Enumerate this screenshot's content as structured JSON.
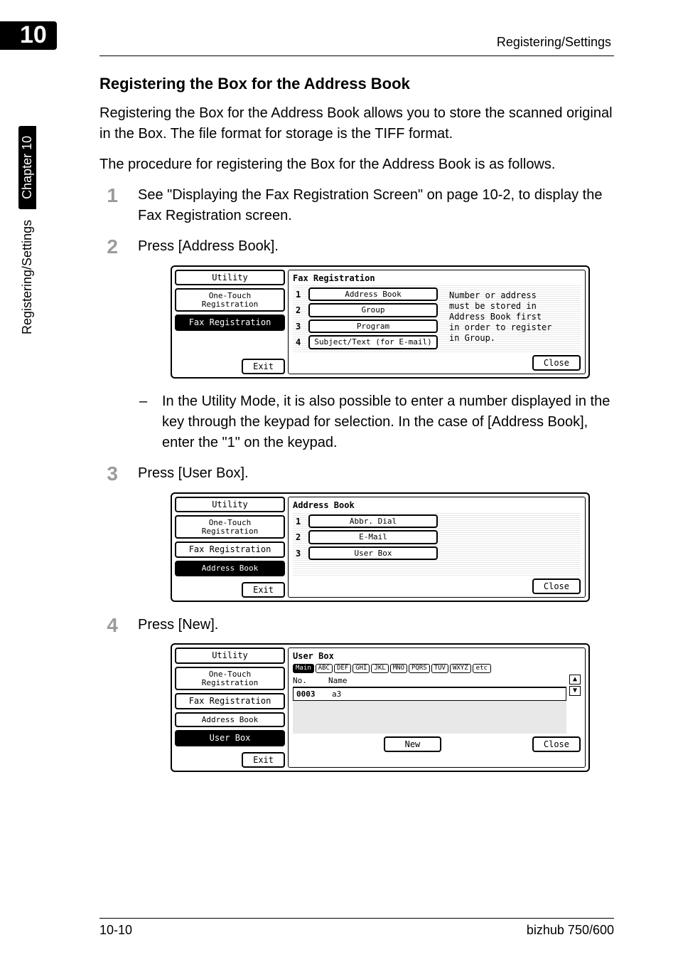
{
  "header": {
    "chapter_number": "10",
    "running_title": "Registering/Settings"
  },
  "side_tab": {
    "text": "Registering/Settings",
    "chapter_label": "Chapter 10"
  },
  "section_title": "Registering the Box for the Address Book",
  "paragraphs": {
    "p1": "Registering the Box for the Address Book allows you to store the scanned original in the Box. The file format for storage is the TIFF format.",
    "p2": "The procedure for registering the Box for the Address Book is as follows."
  },
  "steps": {
    "s1_num": "1",
    "s1_text": "See \"Displaying the Fax Registration Screen\" on page 10-2, to display the Fax Registration screen.",
    "s2_num": "2",
    "s2_text": "Press [Address Book].",
    "sub_dash": "–",
    "sub_text": "In the Utility Mode, it is also possible to enter a number displayed in the key through the keypad for selection. In the case of [Address Book], enter the \"1\" on the keypad.",
    "s3_num": "3",
    "s3_text": "Press [User Box].",
    "s4_num": "4",
    "s4_text": "Press [New]."
  },
  "lcd_common": {
    "left_utility": "Utility",
    "left_onetouch": "One-Touch Registration",
    "left_faxreg": "Fax Registration",
    "left_address": "Address Book",
    "left_userbox": "User Box",
    "exit": "Exit",
    "close": "Close"
  },
  "lcd1": {
    "title": "Fax Registration",
    "m1_n": "1",
    "m1_l": "Address Book",
    "m2_n": "2",
    "m2_l": "Group",
    "m3_n": "3",
    "m3_l": "Program",
    "m4_n": "4",
    "m4_l": "Subject/Text (for E-mail)",
    "hint_l1": "Number or address",
    "hint_l2": "must be stored in",
    "hint_l3": "Address Book first",
    "hint_l4": "in order to register",
    "hint_l5": "in Group."
  },
  "lcd2": {
    "title": "Address Book",
    "m1_n": "1",
    "m1_l": "Abbr. Dial",
    "m2_n": "2",
    "m2_l": "E-Mail",
    "m3_n": "3",
    "m3_l": "User Box"
  },
  "lcd3": {
    "title": "User Box",
    "tabs": {
      "main": "Main",
      "t1": "ABC",
      "t2": "DEF",
      "t3": "GHI",
      "t4": "JKL",
      "t5": "MNO",
      "t6": "PQRS",
      "t7": "TUV",
      "t8": "WXYZ",
      "t9": "etc"
    },
    "col_no": "No.",
    "col_name": "Name",
    "row_no": "0003",
    "row_name": "a3",
    "scroll_up": "▲",
    "scroll_down": "▼",
    "new": "New"
  },
  "footer": {
    "left": "10-10",
    "right": "bizhub 750/600"
  }
}
